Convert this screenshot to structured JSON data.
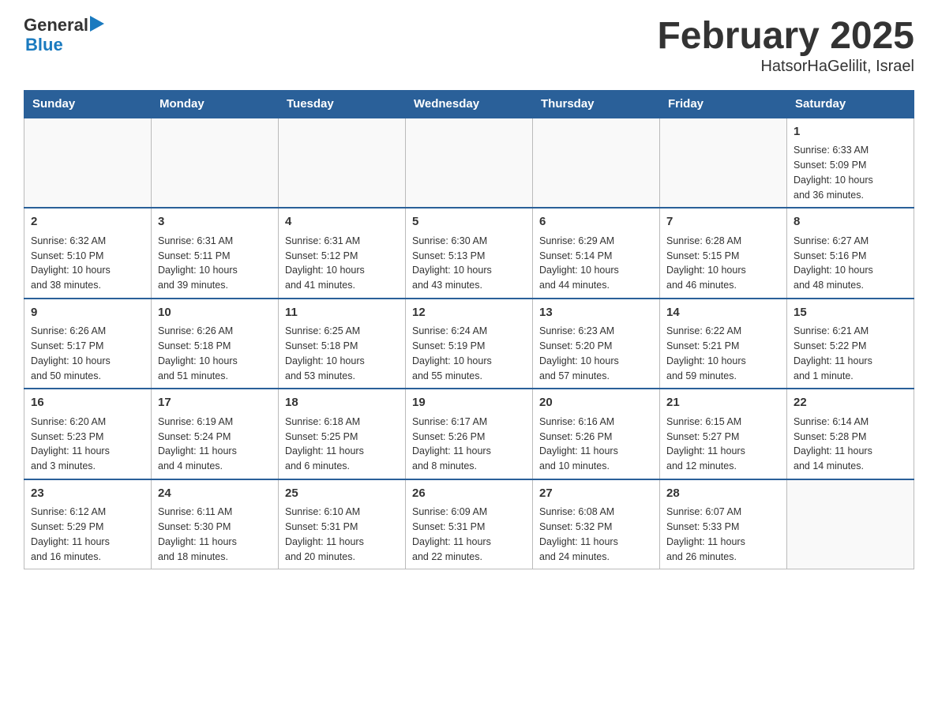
{
  "logo": {
    "line1": "General",
    "triangle": "▶",
    "line2": "Blue"
  },
  "header": {
    "title": "February 2025",
    "subtitle": "HatsorHaGelilit, Israel"
  },
  "weekdays": [
    "Sunday",
    "Monday",
    "Tuesday",
    "Wednesday",
    "Thursday",
    "Friday",
    "Saturday"
  ],
  "weeks": [
    [
      {
        "day": "",
        "info": ""
      },
      {
        "day": "",
        "info": ""
      },
      {
        "day": "",
        "info": ""
      },
      {
        "day": "",
        "info": ""
      },
      {
        "day": "",
        "info": ""
      },
      {
        "day": "",
        "info": ""
      },
      {
        "day": "1",
        "info": "Sunrise: 6:33 AM\nSunset: 5:09 PM\nDaylight: 10 hours\nand 36 minutes."
      }
    ],
    [
      {
        "day": "2",
        "info": "Sunrise: 6:32 AM\nSunset: 5:10 PM\nDaylight: 10 hours\nand 38 minutes."
      },
      {
        "day": "3",
        "info": "Sunrise: 6:31 AM\nSunset: 5:11 PM\nDaylight: 10 hours\nand 39 minutes."
      },
      {
        "day": "4",
        "info": "Sunrise: 6:31 AM\nSunset: 5:12 PM\nDaylight: 10 hours\nand 41 minutes."
      },
      {
        "day": "5",
        "info": "Sunrise: 6:30 AM\nSunset: 5:13 PM\nDaylight: 10 hours\nand 43 minutes."
      },
      {
        "day": "6",
        "info": "Sunrise: 6:29 AM\nSunset: 5:14 PM\nDaylight: 10 hours\nand 44 minutes."
      },
      {
        "day": "7",
        "info": "Sunrise: 6:28 AM\nSunset: 5:15 PM\nDaylight: 10 hours\nand 46 minutes."
      },
      {
        "day": "8",
        "info": "Sunrise: 6:27 AM\nSunset: 5:16 PM\nDaylight: 10 hours\nand 48 minutes."
      }
    ],
    [
      {
        "day": "9",
        "info": "Sunrise: 6:26 AM\nSunset: 5:17 PM\nDaylight: 10 hours\nand 50 minutes."
      },
      {
        "day": "10",
        "info": "Sunrise: 6:26 AM\nSunset: 5:18 PM\nDaylight: 10 hours\nand 51 minutes."
      },
      {
        "day": "11",
        "info": "Sunrise: 6:25 AM\nSunset: 5:18 PM\nDaylight: 10 hours\nand 53 minutes."
      },
      {
        "day": "12",
        "info": "Sunrise: 6:24 AM\nSunset: 5:19 PM\nDaylight: 10 hours\nand 55 minutes."
      },
      {
        "day": "13",
        "info": "Sunrise: 6:23 AM\nSunset: 5:20 PM\nDaylight: 10 hours\nand 57 minutes."
      },
      {
        "day": "14",
        "info": "Sunrise: 6:22 AM\nSunset: 5:21 PM\nDaylight: 10 hours\nand 59 minutes."
      },
      {
        "day": "15",
        "info": "Sunrise: 6:21 AM\nSunset: 5:22 PM\nDaylight: 11 hours\nand 1 minute."
      }
    ],
    [
      {
        "day": "16",
        "info": "Sunrise: 6:20 AM\nSunset: 5:23 PM\nDaylight: 11 hours\nand 3 minutes."
      },
      {
        "day": "17",
        "info": "Sunrise: 6:19 AM\nSunset: 5:24 PM\nDaylight: 11 hours\nand 4 minutes."
      },
      {
        "day": "18",
        "info": "Sunrise: 6:18 AM\nSunset: 5:25 PM\nDaylight: 11 hours\nand 6 minutes."
      },
      {
        "day": "19",
        "info": "Sunrise: 6:17 AM\nSunset: 5:26 PM\nDaylight: 11 hours\nand 8 minutes."
      },
      {
        "day": "20",
        "info": "Sunrise: 6:16 AM\nSunset: 5:26 PM\nDaylight: 11 hours\nand 10 minutes."
      },
      {
        "day": "21",
        "info": "Sunrise: 6:15 AM\nSunset: 5:27 PM\nDaylight: 11 hours\nand 12 minutes."
      },
      {
        "day": "22",
        "info": "Sunrise: 6:14 AM\nSunset: 5:28 PM\nDaylight: 11 hours\nand 14 minutes."
      }
    ],
    [
      {
        "day": "23",
        "info": "Sunrise: 6:12 AM\nSunset: 5:29 PM\nDaylight: 11 hours\nand 16 minutes."
      },
      {
        "day": "24",
        "info": "Sunrise: 6:11 AM\nSunset: 5:30 PM\nDaylight: 11 hours\nand 18 minutes."
      },
      {
        "day": "25",
        "info": "Sunrise: 6:10 AM\nSunset: 5:31 PM\nDaylight: 11 hours\nand 20 minutes."
      },
      {
        "day": "26",
        "info": "Sunrise: 6:09 AM\nSunset: 5:31 PM\nDaylight: 11 hours\nand 22 minutes."
      },
      {
        "day": "27",
        "info": "Sunrise: 6:08 AM\nSunset: 5:32 PM\nDaylight: 11 hours\nand 24 minutes."
      },
      {
        "day": "28",
        "info": "Sunrise: 6:07 AM\nSunset: 5:33 PM\nDaylight: 11 hours\nand 26 minutes."
      },
      {
        "day": "",
        "info": ""
      }
    ]
  ]
}
